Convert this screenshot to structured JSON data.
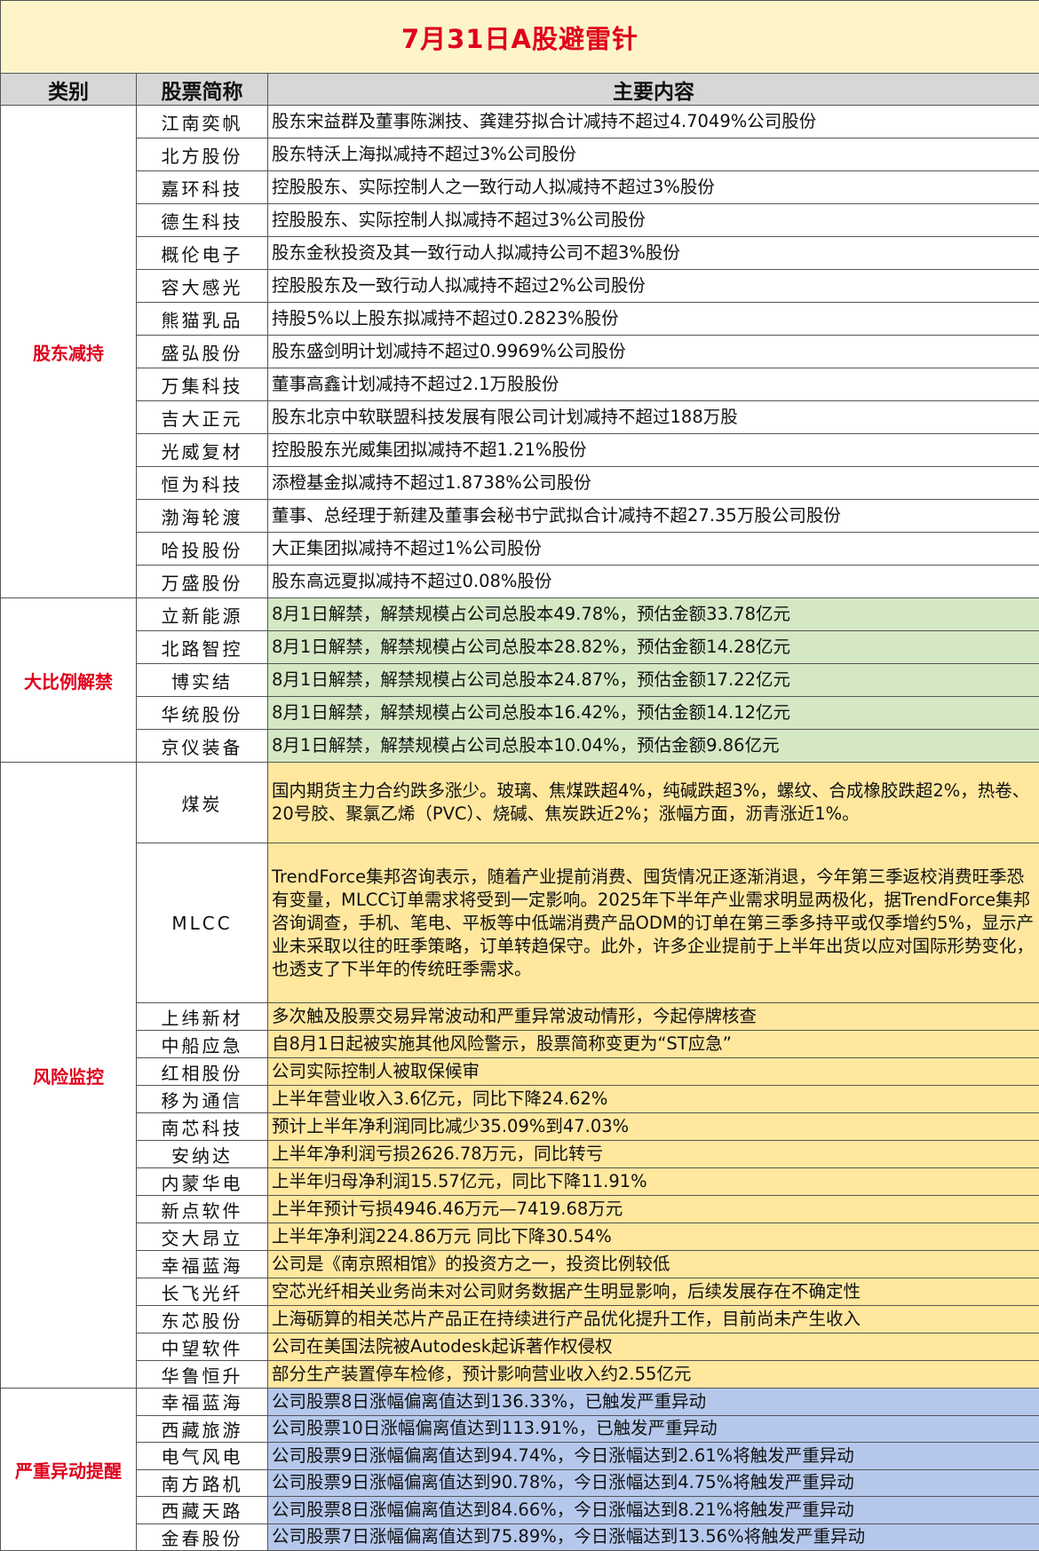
{
  "title": "7月31日A股避雷针",
  "headers": {
    "category": "类别",
    "stock": "股票简称",
    "content": "主要内容"
  },
  "sections": [
    {
      "category": "股东减持",
      "color": "#ffffff",
      "rows": [
        {
          "name": "江南奕帆",
          "content": "股东宋益群及董事陈渊技、龚建芬拟合计减持不超过4.7049%公司股份"
        },
        {
          "name": "北方股份",
          "content": "股东特沃上海拟减持不超过3%公司股份"
        },
        {
          "name": "嘉环科技",
          "content": "控股股东、实际控制人之一致行动人拟减持不超过3%股份"
        },
        {
          "name": "德生科技",
          "content": "控股股东、实际控制人拟减持不超过3%公司股份"
        },
        {
          "name": "概伦电子",
          "content": "股东金秋投资及其一致行动人拟减持公司不超3%股份"
        },
        {
          "name": "容大感光",
          "content": "控股股东及一致行动人拟减持不超过2%公司股份"
        },
        {
          "name": "熊猫乳品",
          "content": "持股5%以上股东拟减持不超过0.2823%股份"
        },
        {
          "name": "盛弘股份",
          "content": "股东盛剑明计划减持不超过0.9969%公司股份"
        },
        {
          "name": "万集科技",
          "content": "董事高鑫计划减持不超过2.1万股股份"
        },
        {
          "name": "吉大正元",
          "content": "股东北京中软联盟科技发展有限公司计划减持不超过188万股"
        },
        {
          "name": "光威复材",
          "content": "控股股东光威集团拟减持不超1.21%股份"
        },
        {
          "name": "恒为科技",
          "content": "添橙基金拟减持不超过1.8738%公司股份"
        },
        {
          "name": "渤海轮渡",
          "content": "董事、总经理于新建及董事会秘书宁武拟合计减持不超27.35万股公司股份"
        },
        {
          "name": "哈投股份",
          "content": "大正集团拟减持不超过1%公司股份"
        },
        {
          "name": "万盛股份",
          "content": "股东高远夏拟减持不超过0.08%股份"
        }
      ]
    },
    {
      "category": "大比例解禁",
      "color": "#d5e8c4",
      "rows": [
        {
          "name": "立新能源",
          "content": "8月1日解禁，解禁规模占公司总股本49.78%，预估金额33.78亿元"
        },
        {
          "name": "北路智控",
          "content": "8月1日解禁，解禁规模占公司总股本28.82%，预估金额14.28亿元"
        },
        {
          "name": "博实结",
          "content": "8月1日解禁，解禁规模占公司总股本24.87%，预估金额17.22亿元"
        },
        {
          "name": "华统股份",
          "content": "8月1日解禁，解禁规模占公司总股本16.42%，预估金额14.12亿元"
        },
        {
          "name": "京仪装备",
          "content": "8月1日解禁，解禁规模占公司总股本10.04%，预估金额9.86亿元"
        }
      ]
    },
    {
      "category": "风险监控",
      "color": "#ffe79e",
      "rows": [
        {
          "name": "煤炭",
          "content": "国内期货主力合约跌多涨少。玻璃、焦煤跌超4%，纯碱跌超3%，螺纹、合成橡胶跌超2%，热卷、20号胶、聚氯乙烯（PVC）、烧碱、焦炭跌近2%；涨幅方面，沥青涨近1%。"
        },
        {
          "name": "MLCC",
          "content": "TrendForce集邦咨询表示，随着产业提前消费、囤货情况正逐渐消退，今年第三季返校消费旺季恐有变量，MLCC订单需求将受到一定影响。2025年下半年产业需求明显两极化，据TrendForce集邦咨询调查，手机、笔电、平板等中低端消费产品ODM的订单在第三季多持平或仅季增约5%，显示产业未采取以往的旺季策略，订单转趋保守。此外，许多企业提前于上半年出货以应对国际形势变化，也透支了下半年的传统旺季需求。"
        },
        {
          "name": "上纬新材",
          "content": "多次触及股票交易异常波动和严重异常波动情形，今起停牌核查"
        },
        {
          "name": "中船应急",
          "content": "自8月1日起被实施其他风险警示，股票简称变更为“ST应急”"
        },
        {
          "name": "红相股份",
          "content": "公司实际控制人被取保候审"
        },
        {
          "name": "移为通信",
          "content": "上半年营业收入3.6亿元，同比下降24.62%"
        },
        {
          "name": "南芯科技",
          "content": "预计上半年净利润同比减少35.09%到47.03%"
        },
        {
          "name": "安纳达",
          "content": "上半年净利润亏损2626.78万元，同比转亏"
        },
        {
          "name": "内蒙华电",
          "content": "上半年归母净利润15.57亿元，同比下降11.91%"
        },
        {
          "name": "新点软件",
          "content": "上半年预计亏损4946.46万元—7419.68万元"
        },
        {
          "name": "交大昂立",
          "content": "上半年净利润224.86万元 同比下降30.54%"
        },
        {
          "name": "幸福蓝海",
          "content": "公司是《南京照相馆》的投资方之一，投资比例较低"
        },
        {
          "name": "长飞光纤",
          "content": "空芯光纤相关业务尚未对公司财务数据产生明显影响，后续发展存在不确定性"
        },
        {
          "name": "东芯股份",
          "content": "上海砺算的相关芯片产品正在持续进行产品优化提升工作，目前尚未产生收入"
        },
        {
          "name": "中望软件",
          "content": "公司在美国法院被Autodesk起诉著作权侵权"
        },
        {
          "name": "华鲁恒升",
          "content": "部分生产装置停车检修，预计影响营业收入约2.55亿元"
        }
      ]
    },
    {
      "category": "严重异动提醒",
      "color": "#b5c8ec",
      "rows": [
        {
          "name": "幸福蓝海",
          "content": "公司股票8日涨幅偏离值达到136.33%，已触发严重异动"
        },
        {
          "name": "西藏旅游",
          "content": "公司股票10日涨幅偏离值达到113.91%，已触发严重异动"
        },
        {
          "name": "电气风电",
          "content": "公司股票9日涨幅偏离值达到94.74%，今日涨幅达到2.61%将触发严重异动"
        },
        {
          "name": "南方路机",
          "content": "公司股票9日涨幅偏离值达到90.78%，今日涨幅达到4.75%将触发严重异动"
        },
        {
          "name": "西藏天路",
          "content": "公司股票8日涨幅偏离值达到84.66%，今日涨幅达到8.21%将触发严重异动"
        },
        {
          "name": "金春股份",
          "content": "公司股票7日涨幅偏离值达到75.89%，今日涨幅达到13.56%将触发严重异动"
        }
      ]
    }
  ]
}
